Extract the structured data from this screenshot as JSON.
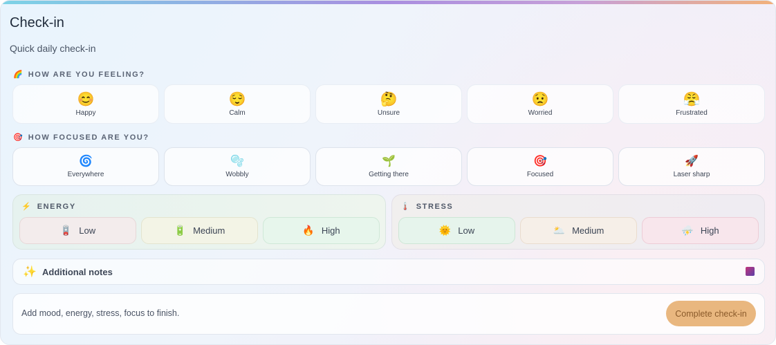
{
  "header": {
    "title": "Check-in",
    "subtitle": "Quick daily check-in"
  },
  "feeling": {
    "icon": "🌈",
    "label": "HOW ARE YOU FEELING?",
    "options": [
      {
        "emoji": "😊",
        "label": "Happy"
      },
      {
        "emoji": "😌",
        "label": "Calm"
      },
      {
        "emoji": "🤔",
        "label": "Unsure"
      },
      {
        "emoji": "😟",
        "label": "Worried"
      },
      {
        "emoji": "😤",
        "label": "Frustrated"
      }
    ]
  },
  "focus": {
    "icon": "🎯",
    "label": "HOW FOCUSED ARE YOU?",
    "options": [
      {
        "emoji": "🌀",
        "label": "Everywhere"
      },
      {
        "emoji": "🫧",
        "label": "Wobbly"
      },
      {
        "emoji": "🌱",
        "label": "Getting there"
      },
      {
        "emoji": "🎯",
        "label": "Focused"
      },
      {
        "emoji": "🚀",
        "label": "Laser sharp"
      }
    ]
  },
  "energy": {
    "icon": "⚡",
    "label": "ENERGY",
    "options": [
      {
        "emoji": "🪫",
        "label": "Low",
        "bg": "#f3ecec",
        "border": "#e6d7d7"
      },
      {
        "emoji": "🔋",
        "label": "Medium",
        "bg": "#f3f4e6",
        "border": "#e3e4cf"
      },
      {
        "emoji": "🔥",
        "label": "High",
        "bg": "#e7f6ec",
        "border": "#cfe8d7"
      }
    ]
  },
  "stress": {
    "icon": "🌡️",
    "label": "STRESS",
    "options": [
      {
        "emoji": "🌞",
        "label": "Low",
        "bg": "#e6f4ec",
        "border": "#cde6d6"
      },
      {
        "emoji": "🌥️",
        "label": "Medium",
        "bg": "#f6efe8",
        "border": "#eadcce"
      },
      {
        "emoji": "⛈️",
        "label": "High",
        "bg": "#f8e6ec",
        "border": "#edccd6"
      }
    ]
  },
  "notes": {
    "icon": "✨",
    "label": "Additional notes"
  },
  "footer": {
    "message": "Add mood, energy, stress, focus to finish.",
    "button_label": "Complete check-in",
    "button_color": "#e9b77f"
  }
}
